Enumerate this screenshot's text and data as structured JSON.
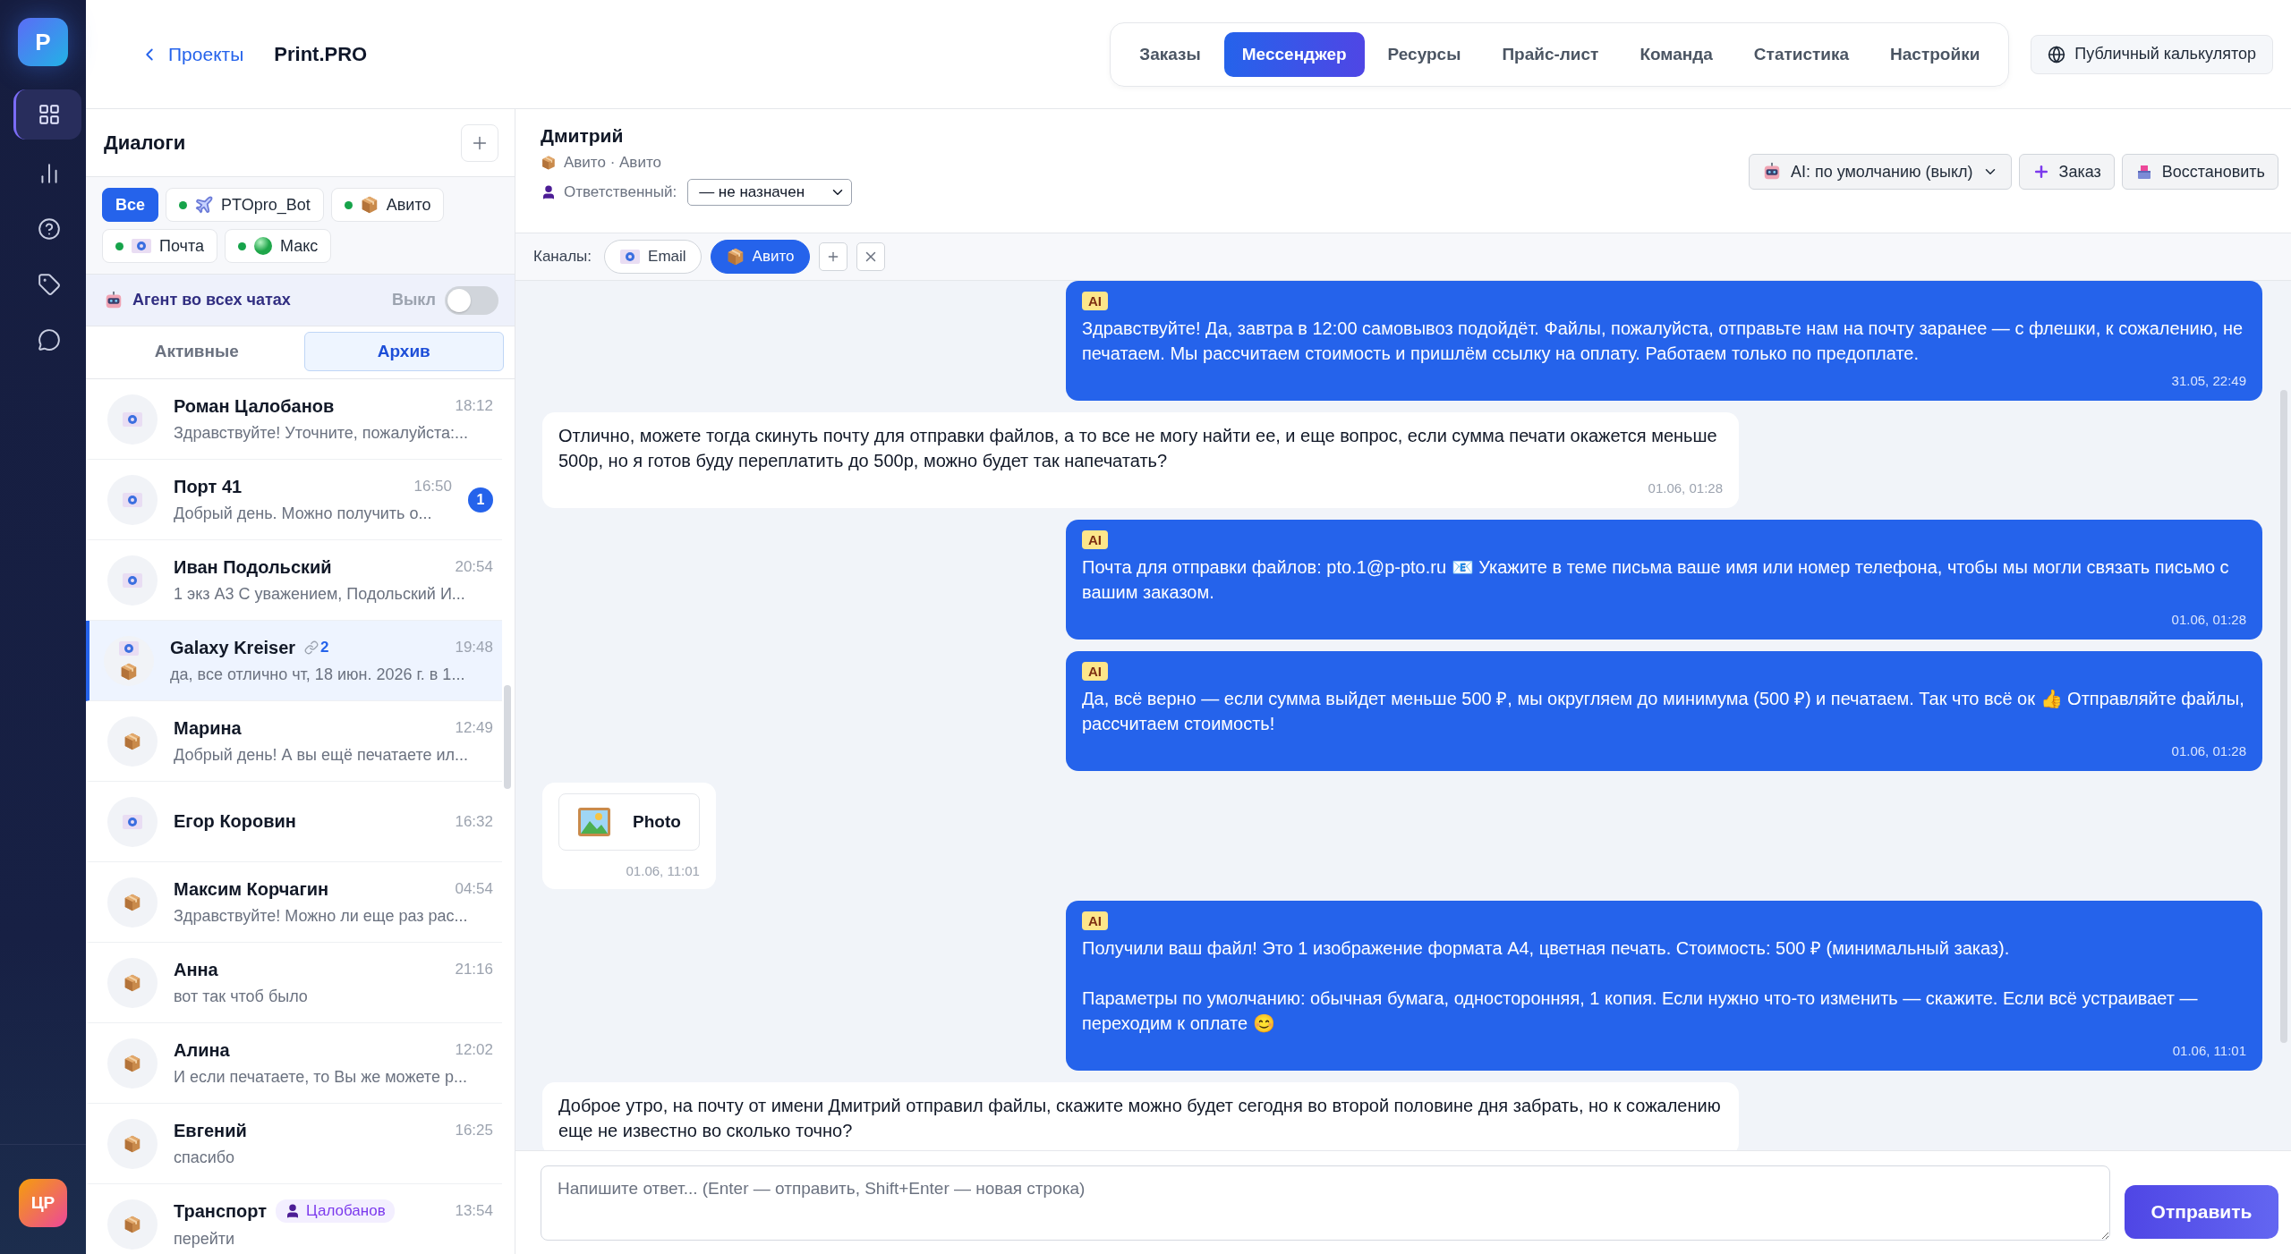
{
  "rail": {
    "logo": "P",
    "nav": [
      {
        "kind": "grid",
        "selected": true
      },
      {
        "kind": "chart",
        "selected": false
      },
      {
        "kind": "help",
        "selected": false
      },
      {
        "kind": "tag",
        "selected": false
      },
      {
        "kind": "chat",
        "selected": false
      }
    ],
    "user_avatar": "ЦР"
  },
  "header": {
    "back_link": "Проекты",
    "project": "Print.PRO",
    "tabs": [
      {
        "label": "Заказы",
        "selected": false
      },
      {
        "label": "Мессенджер",
        "selected": true
      },
      {
        "label": "Ресурсы",
        "selected": false
      },
      {
        "label": "Прайс-лист",
        "selected": false
      },
      {
        "label": "Команда",
        "selected": false
      },
      {
        "label": "Статистика",
        "selected": false
      },
      {
        "label": "Настройки",
        "selected": false
      }
    ],
    "public_button": "Публичный калькулятор"
  },
  "dialogs": {
    "title": "Диалоги",
    "filters": [
      {
        "label": "Все",
        "selected": true
      },
      {
        "label": "PTOpro_Bot",
        "kind": "bot",
        "online": true,
        "selected": false
      },
      {
        "label": "Авито",
        "kind": "avito",
        "online": true,
        "selected": false
      },
      {
        "label": "Почта",
        "kind": "mail",
        "online": true,
        "selected": false
      },
      {
        "label": "Макс",
        "kind": "max",
        "online": true,
        "selected": false
      }
    ],
    "agent": {
      "label": "Агент во всех чатах",
      "state_label": "Выкл",
      "on": false
    },
    "tabs": [
      {
        "label": "Активные",
        "selected": false
      },
      {
        "label": "Архив",
        "selected": true
      }
    ],
    "conversations": [
      {
        "name": "Роман Цалобанов",
        "time": "18:12",
        "preview": "Здравствуйте! Уточните, пожалуйста:...",
        "channels": [
          {
            "kind": "mail"
          }
        ],
        "selected": false
      },
      {
        "name": "Порт 41",
        "time": "16:50",
        "preview": "Добрый день. Можно получить о...",
        "channels": [
          {
            "kind": "mail"
          }
        ],
        "unread": "1",
        "selected": false
      },
      {
        "name": "Иван Подольский",
        "time": "20:54",
        "preview": "1 экз А3 С уважением, Подольский И...",
        "channels": [
          {
            "kind": "mail"
          }
        ],
        "selected": false
      },
      {
        "name": "Galaxy Kreiser",
        "time": "19:48",
        "preview": "да, все отлично чт, 18 июн. 2026 г. в 1...",
        "channels": [
          {
            "kind": "mail"
          },
          {
            "kind": "avito"
          }
        ],
        "links": "2",
        "selected": true
      },
      {
        "name": "Марина",
        "time": "12:49",
        "preview": "Добрый день! А вы ещё печатаете ил...",
        "channels": [
          {
            "kind": "avito"
          }
        ],
        "selected": false
      },
      {
        "name": "Егор Коровин",
        "time": "16:32",
        "channels": [
          {
            "kind": "mail"
          }
        ],
        "selected": false
      },
      {
        "name": "Максим Корчагин",
        "time": "04:54",
        "preview": "Здравствуйте! Можно ли еще раз рас...",
        "channels": [
          {
            "kind": "avito"
          }
        ],
        "selected": false
      },
      {
        "name": "Анна",
        "time": "21:16",
        "preview": "вот так чтоб было",
        "channels": [
          {
            "kind": "avito"
          }
        ],
        "selected": false
      },
      {
        "name": "Алина",
        "time": "12:02",
        "preview": "И если печатаете, то Вы же можете р...",
        "channels": [
          {
            "kind": "avito"
          }
        ],
        "selected": false
      },
      {
        "name": "Евгений",
        "time": "16:25",
        "preview": "спасибо",
        "channels": [
          {
            "kind": "avito"
          }
        ],
        "selected": false
      },
      {
        "name": "Транспорт",
        "time": "13:54",
        "preview": "перейти",
        "channels": [
          {
            "kind": "avito"
          }
        ],
        "assignee": "Цалобанов",
        "selected": false
      }
    ]
  },
  "chat": {
    "name": "Дмитрий",
    "source": "Авито · Авито",
    "responsible_label": "Ответственный:",
    "responsible_value": "— не назначен",
    "ai_select": "AI: по умолчанию (выкл)",
    "order_button": "Заказ",
    "restore_button": "Восстановить",
    "channels_label": "Каналы:",
    "channels": [
      {
        "label": "Email",
        "kind": "mail",
        "selected": false
      },
      {
        "label": "Авито",
        "kind": "avito",
        "selected": true
      }
    ],
    "messages": [
      {
        "kind": "text",
        "outgoing": true,
        "badge": "AI",
        "text": "Здравствуйте! Да, завтра в 12:00 самовывоз подойдёт. Файлы, пожалуйста, отправьте нам на почту заранее — с флешки, к сожалению, не печатаем. Мы рассчитаем стоимость и пришлём ссылку на оплату. Работаем только по предоплате.",
        "time": "31.05, 22:49"
      },
      {
        "kind": "text",
        "outgoing": false,
        "text": "Отлично, можете тогда скинуть почту для отправки файлов, а то все не могу найти ее, и еще вопрос, если сумма печати окажется меньше 500р, но я готов буду переплатить до 500р, можно будет так напечатать?",
        "time": "01.06, 01:28"
      },
      {
        "kind": "text",
        "outgoing": true,
        "badge": "AI",
        "text": "Почта для отправки файлов: pto.1@p-pto.ru 📧 Укажите в теме письма ваше имя или номер телефона, чтобы мы могли связать письмо с вашим заказом.",
        "time": "01.06, 01:28"
      },
      {
        "kind": "text",
        "outgoing": true,
        "badge": "AI",
        "text": "Да, всё верно — если сумма выйдет меньше 500 ₽, мы округляем до минимума (500 ₽) и печатаем. Так что всё ок 👍 Отправляйте файлы, рассчитаем стоимость!",
        "time": "01.06, 01:28"
      },
      {
        "kind": "photo",
        "outgoing": false,
        "label": "Photo",
        "time": "01.06, 11:01"
      },
      {
        "kind": "text",
        "outgoing": true,
        "badge": "AI",
        "text": "Получили ваш файл! Это 1 изображение формата А4, цветная печать. Стоимость: 500 ₽ (минимальный заказ).\n\nПараметры по умолчанию: обычная бумага, односторонняя, 1 копия. Если нужно что-то изменить — скажите. Если всё устраивает — переходим к оплате 😊",
        "time": "01.06, 11:01"
      },
      {
        "kind": "text",
        "outgoing": false,
        "text": "Доброе утро, на почту от имени  Дмитрий отправил файлы, скажите можно будет сегодня во второй половине дня забрать, но к сожалению еще не известно во сколько точно?"
      }
    ]
  },
  "composer": {
    "placeholder": "Напишите ответ... (Enter — отправить, Shift+Enter — новая строка)",
    "send": "Отправить"
  }
}
